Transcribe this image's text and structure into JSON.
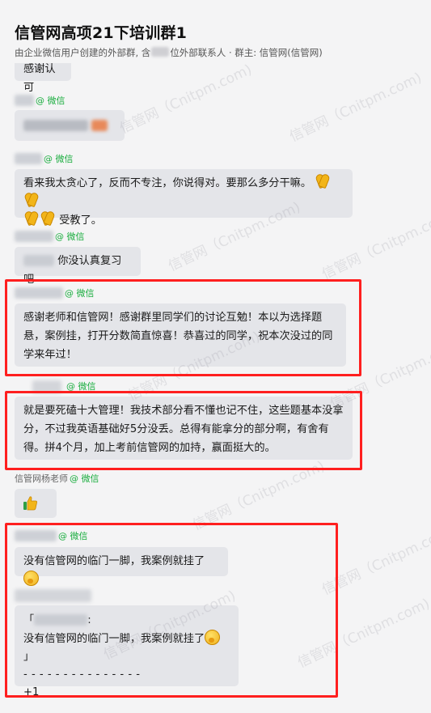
{
  "header": {
    "title": "信管网高项21下培训群1",
    "subtitle_prefix": "由企业微信用户创建的外部群, 含",
    "subtitle_suffix": "位外部联系人 · 群主: 信管网(信管网)"
  },
  "watermark": "信管网（Cnitpm.com)",
  "wechat_tag": "@ 微信",
  "messages": {
    "m0": {
      "text": "感谢认可"
    },
    "m3": {
      "text": "你没认真复习吧"
    },
    "m2": {
      "line1": "看来我太贪心了，反而不专注，你说得对。要那么多分干嘛。",
      "line2": "受教了。"
    },
    "m4": {
      "text": "感谢老师和信管网！感谢群里同学们的讨论互勉！本以为选择题悬，案例挂，打开分数简直惊喜！恭喜过的同学，祝本次没过的同学来年过！"
    },
    "m5": {
      "text": "就是要死磕十大管理！我技术部分看不懂也记不住，这些题基本没拿分，不过我英语基础好5分没丢。总得有能拿分的部分啊，有舍有得。拼4个月，加上考前信管网的加持，赢面挺大的。"
    },
    "m6": {
      "sender": "信管网杨老师"
    },
    "m7": {
      "text": "没有信管网的临门一脚，我案例就挂了"
    },
    "m8": {
      "quote_open": "「",
      "quote_colon": ":",
      "quote_text": "没有信管网的临门一脚，我案例就挂了",
      "quote_close": "」",
      "divider": "- - - - - - - - - - - - - - -",
      "reply": "+1"
    }
  }
}
